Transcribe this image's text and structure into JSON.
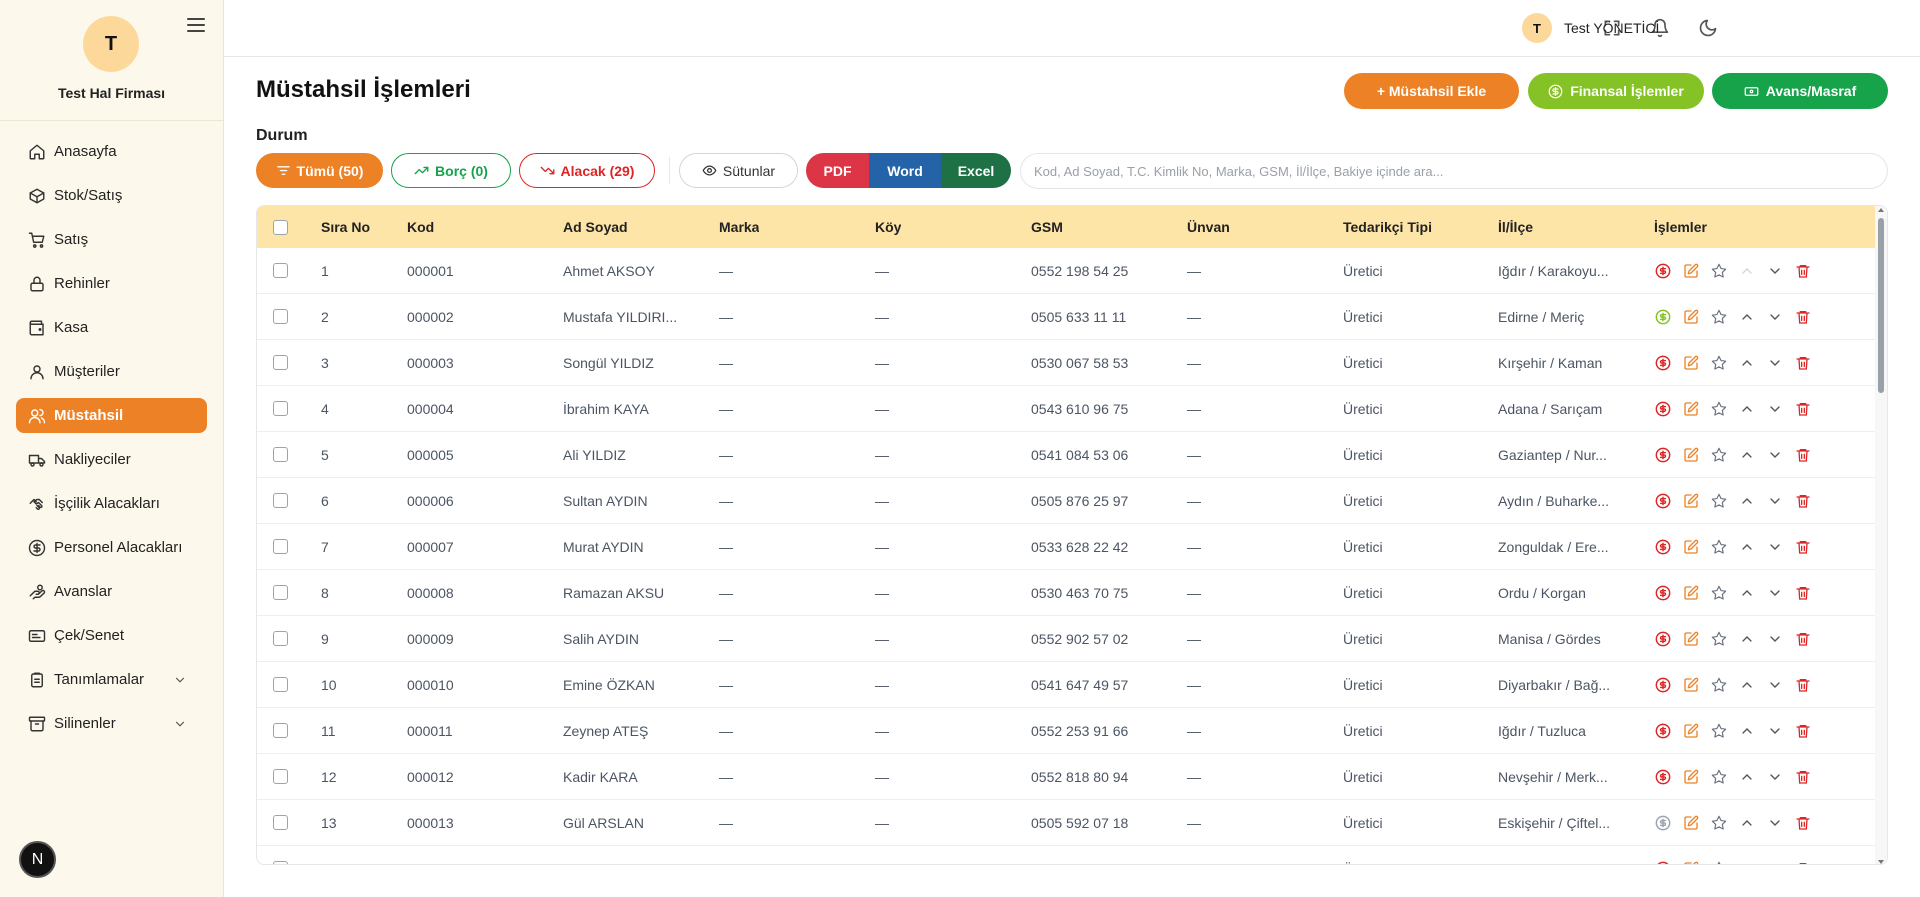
{
  "app": {
    "firm_initial": "T",
    "firm_name": "Test Hal Firması"
  },
  "sidebar": {
    "items": [
      {
        "label": "Anasayfa",
        "icon": "home-icon"
      },
      {
        "label": "Stok/Satış",
        "icon": "box-icon"
      },
      {
        "label": "Satış",
        "icon": "cart-icon"
      },
      {
        "label": "Rehinler",
        "icon": "lock-icon"
      },
      {
        "label": "Kasa",
        "icon": "wallet-icon"
      },
      {
        "label": "Müşteriler",
        "icon": "user-icon"
      },
      {
        "label": "Müstahsil",
        "icon": "users-icon",
        "active": true
      },
      {
        "label": "Nakliyeciler",
        "icon": "truck-icon"
      },
      {
        "label": "İşçilik Alacakları",
        "icon": "handshake-icon"
      },
      {
        "label": "Personel Alacakları",
        "icon": "dollar-circle-icon"
      },
      {
        "label": "Avanslar",
        "icon": "hand-coins-icon"
      },
      {
        "label": "Çek/Senet",
        "icon": "check-icon"
      },
      {
        "label": "Tanımlamalar",
        "icon": "clipboard-icon",
        "expandable": true
      },
      {
        "label": "Silinenler",
        "icon": "archive-icon",
        "expandable": true
      }
    ],
    "bottom_badge": "N"
  },
  "topbar": {
    "user_initial": "T",
    "user_name": "Test YÖNETİCİ"
  },
  "page": {
    "title": "Müstahsil İşlemleri",
    "add_button": "+ Müstahsil Ekle",
    "finance_button": "Finansal İşlemler",
    "advance_button": "Avans/Masraf",
    "durum_label": "Durum",
    "filters": {
      "all": "Tümü (50)",
      "debt": "Borç (0)",
      "credit": "Alacak (29)"
    },
    "columns_button": "Sütunlar",
    "export": {
      "pdf": "PDF",
      "word": "Word",
      "excel": "Excel"
    },
    "search_placeholder": "Kod, Ad Soyad, T.C. Kimlik No, Marka, GSM, İl/İlçe, Bakiye içinde ara..."
  },
  "colors": {
    "accent": "#ec8225",
    "green": "#16a34a",
    "lime": "#84c225",
    "red": "#dc2626",
    "blue": "#2563a8",
    "excel": "#1e7145",
    "header": "#fde4a7"
  },
  "table": {
    "headers": [
      "Sıra No",
      "Kod",
      "Ad Soyad",
      "Marka",
      "Köy",
      "GSM",
      "Ünvan",
      "Tedarikçi Tipi",
      "İl/İlçe",
      "İşlemler"
    ],
    "rows": [
      {
        "no": "1",
        "kod": "000001",
        "ad": "Ahmet AKSOY",
        "marka": "—",
        "koy": "—",
        "gsm": "0552 198 54 25",
        "unvan": "—",
        "tip": "Üretici",
        "il": "Iğdır / Karakoyu...",
        "money": "red",
        "up": false
      },
      {
        "no": "2",
        "kod": "000002",
        "ad": "Mustafa YILDIRI...",
        "marka": "—",
        "koy": "—",
        "gsm": "0505 633 11 11",
        "unvan": "—",
        "tip": "Üretici",
        "il": "Edirne / Meriç",
        "money": "green",
        "up": true
      },
      {
        "no": "3",
        "kod": "000003",
        "ad": "Songül YILDIZ",
        "marka": "—",
        "koy": "—",
        "gsm": "0530 067 58 53",
        "unvan": "—",
        "tip": "Üretici",
        "il": "Kırşehir / Kaman",
        "money": "red",
        "up": true
      },
      {
        "no": "4",
        "kod": "000004",
        "ad": "İbrahim KAYA",
        "marka": "—",
        "koy": "—",
        "gsm": "0543 610 96 75",
        "unvan": "—",
        "tip": "Üretici",
        "il": "Adana / Sarıçam",
        "money": "red",
        "up": true
      },
      {
        "no": "5",
        "kod": "000005",
        "ad": "Ali YILDIZ",
        "marka": "—",
        "koy": "—",
        "gsm": "0541 084 53 06",
        "unvan": "—",
        "tip": "Üretici",
        "il": "Gaziantep / Nur...",
        "money": "red",
        "up": true
      },
      {
        "no": "6",
        "kod": "000006",
        "ad": "Sultan AYDIN",
        "marka": "—",
        "koy": "—",
        "gsm": "0505 876 25 97",
        "unvan": "—",
        "tip": "Üretici",
        "il": "Aydın / Buharke...",
        "money": "red",
        "up": true
      },
      {
        "no": "7",
        "kod": "000007",
        "ad": "Murat AYDIN",
        "marka": "—",
        "koy": "—",
        "gsm": "0533 628 22 42",
        "unvan": "—",
        "tip": "Üretici",
        "il": "Zonguldak / Ere...",
        "money": "red",
        "up": true
      },
      {
        "no": "8",
        "kod": "000008",
        "ad": "Ramazan AKSU",
        "marka": "—",
        "koy": "—",
        "gsm": "0530 463 70 75",
        "unvan": "—",
        "tip": "Üretici",
        "il": "Ordu / Korgan",
        "money": "red",
        "up": true
      },
      {
        "no": "9",
        "kod": "000009",
        "ad": "Salih AYDIN",
        "marka": "—",
        "koy": "—",
        "gsm": "0552 902 57 02",
        "unvan": "—",
        "tip": "Üretici",
        "il": "Manisa / Gördes",
        "money": "red",
        "up": true
      },
      {
        "no": "10",
        "kod": "000010",
        "ad": "Emine ÖZKAN",
        "marka": "—",
        "koy": "—",
        "gsm": "0541 647 49 57",
        "unvan": "—",
        "tip": "Üretici",
        "il": "Diyarbakır / Bağ...",
        "money": "red",
        "up": true
      },
      {
        "no": "11",
        "kod": "000011",
        "ad": "Zeynep ATEŞ",
        "marka": "—",
        "koy": "—",
        "gsm": "0552 253 91 66",
        "unvan": "—",
        "tip": "Üretici",
        "il": "Iğdır / Tuzluca",
        "money": "red",
        "up": true
      },
      {
        "no": "12",
        "kod": "000012",
        "ad": "Kadir KARA",
        "marka": "—",
        "koy": "—",
        "gsm": "0552 818 80 94",
        "unvan": "—",
        "tip": "Üretici",
        "il": "Nevşehir / Merk...",
        "money": "red",
        "up": true
      },
      {
        "no": "13",
        "kod": "000013",
        "ad": "Gül ARSLAN",
        "marka": "—",
        "koy": "—",
        "gsm": "0505 592 07 18",
        "unvan": "—",
        "tip": "Üretici",
        "il": "Eskişehir / Çiftel...",
        "money": "gray",
        "up": true
      },
      {
        "no": "",
        "kod": "",
        "ad": "",
        "marka": "",
        "koy": "",
        "gsm": "",
        "unvan": "",
        "tip": "Ü",
        "il": "",
        "money": "red",
        "up": true
      }
    ]
  }
}
